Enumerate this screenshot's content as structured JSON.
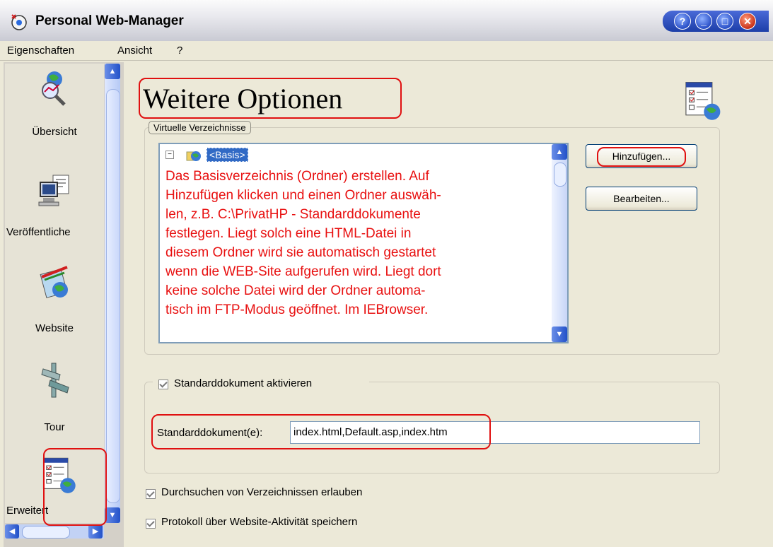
{
  "window": {
    "title": "Personal Web-Manager"
  },
  "menu": [
    "Eigenschaften",
    "Ansicht",
    "?"
  ],
  "sidebar": {
    "items": [
      {
        "label": "Übersicht",
        "icon": "overview-icon"
      },
      {
        "label": "Veröffentliche",
        "icon": "publish-icon"
      },
      {
        "label": "Website",
        "icon": "website-icon"
      },
      {
        "label": "Tour",
        "icon": "tour-icon"
      },
      {
        "label": "Erweitert",
        "icon": "advanced-icon"
      }
    ]
  },
  "main": {
    "title": "Weitere Optionen",
    "virtual_dirs": {
      "legend": "Virtuelle Verzeichnisse",
      "tree_root": "<Basis>",
      "add_button": "Hinzufügen...",
      "edit_button": "Bearbeiten..."
    },
    "explanation": [
      "Das Basisverzeichnis (Ordner) erstellen. Auf",
      "Hinzufügen klicken und einen Ordner auswäh-",
      "len, z.B. C:\\PrivatHP - Standarddokumente",
      "festlegen. Liegt solch eine HTML-Datei in",
      "diesem Ordner wird sie automatisch gestartet",
      "wenn die WEB-Site aufgerufen wird. Liegt dort",
      "keine solche Datei wird der Ordner automa-",
      "tisch im FTP-Modus geöffnet. Im IEBrowser."
    ],
    "default_doc": {
      "checkbox_label": "Standarddokument aktivieren",
      "field_label": "Standarddokument(e):",
      "field_value": "index.html,Default.asp,index.htm"
    },
    "browse_dirs_label": "Durchsuchen von Verzeichnissen erlauben",
    "log_label": "Protokoll über Website-Aktivität speichern"
  },
  "colors": {
    "annotation_red": "#e01010",
    "selection_blue": "#316ac5"
  }
}
